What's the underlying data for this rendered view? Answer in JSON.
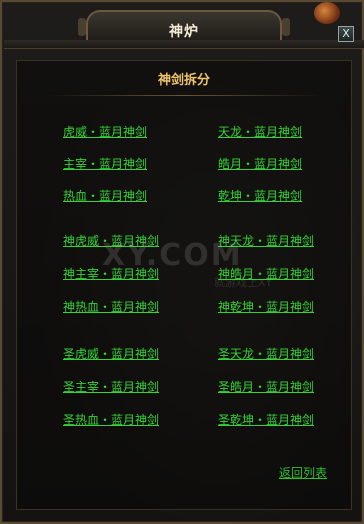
{
  "window": {
    "title": "神炉",
    "close_label": "X"
  },
  "panel": {
    "heading": "神剑拆分",
    "back_label": "返回列表"
  },
  "watermark": {
    "main": "XY.COM",
    "sub": "就游戏上XY"
  },
  "groups": [
    {
      "left": [
        "虎威・蓝月神剑",
        "主宰・蓝月神剑",
        "热血・蓝月神剑"
      ],
      "right": [
        "天龙・蓝月神剑",
        "皓月・蓝月神剑",
        "乾坤・蓝月神剑"
      ]
    },
    {
      "left": [
        "神虎威・蓝月神剑",
        "神主宰・蓝月神剑",
        "神热血・蓝月神剑"
      ],
      "right": [
        "神天龙・蓝月神剑",
        "神皓月・蓝月神剑",
        "神乾坤・蓝月神剑"
      ]
    },
    {
      "left": [
        "圣虎威・蓝月神剑",
        "圣主宰・蓝月神剑",
        "圣热血・蓝月神剑"
      ],
      "right": [
        "圣天龙・蓝月神剑",
        "圣皓月・蓝月神剑",
        "圣乾坤・蓝月神剑"
      ]
    }
  ]
}
